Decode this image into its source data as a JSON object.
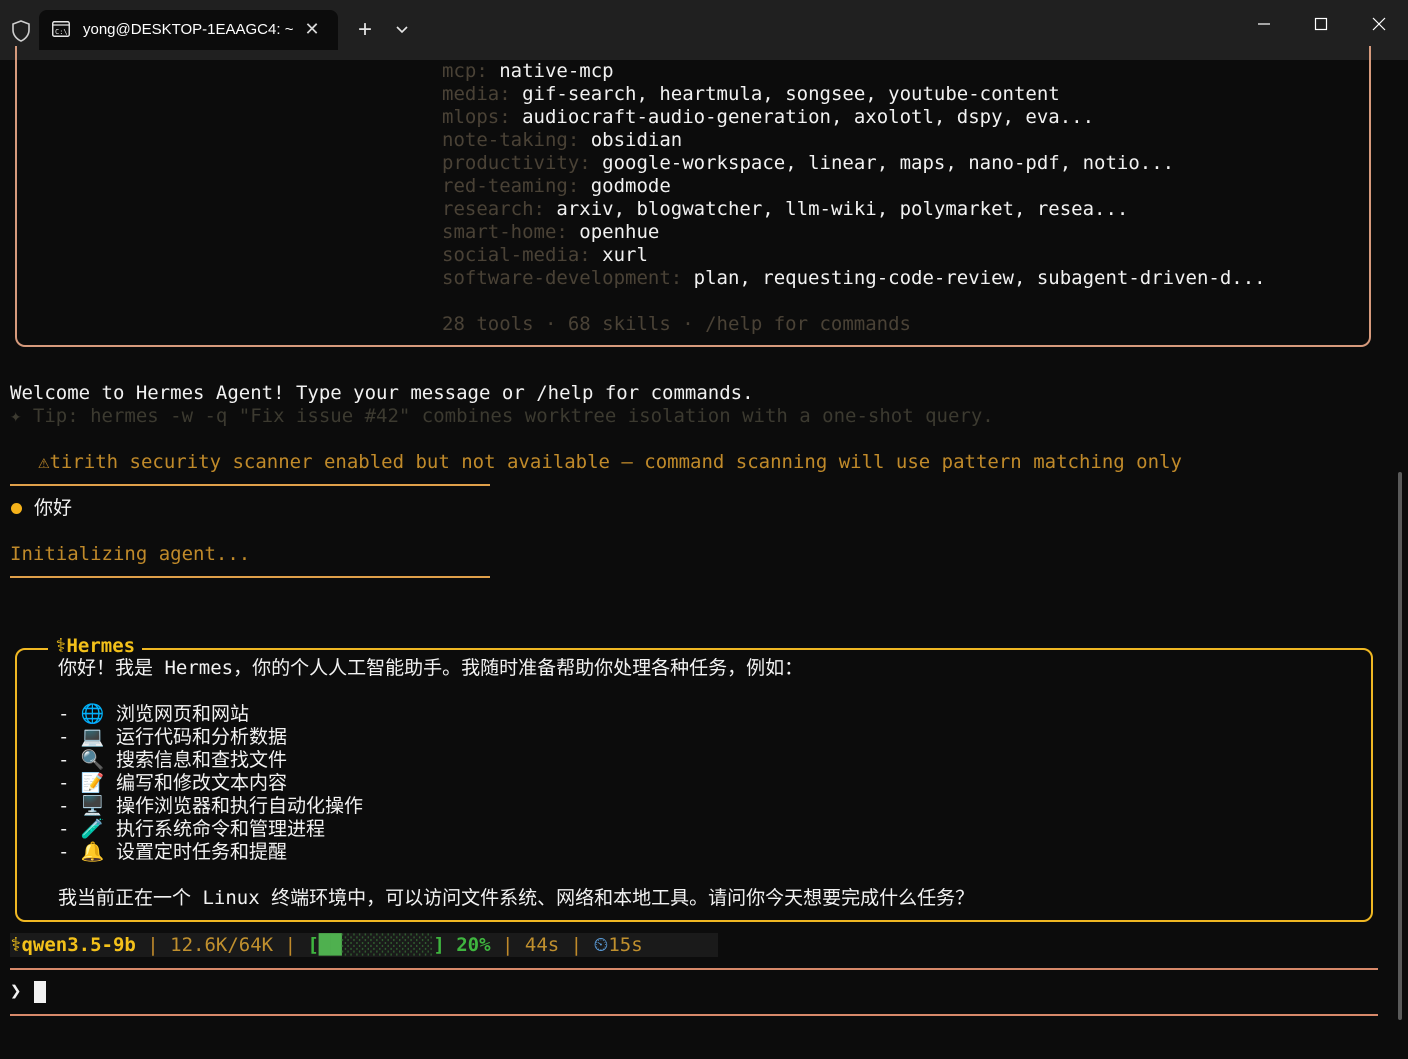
{
  "window": {
    "tab_title": "yong@DESKTOP-1EAAGC4: ~",
    "new_tab_label": "+"
  },
  "banner": {
    "skills": [
      {
        "category": "mcp:",
        "items": "native-mcp"
      },
      {
        "category": "media:",
        "items": "gif-search, heartmula, songsee, youtube-content"
      },
      {
        "category": "mlops:",
        "items": "audiocraft-audio-generation, axolotl, dspy, eva..."
      },
      {
        "category": "note-taking:",
        "items": "obsidian"
      },
      {
        "category": "productivity:",
        "items": "google-workspace, linear, maps, nano-pdf, notio..."
      },
      {
        "category": "red-teaming:",
        "items": "godmode"
      },
      {
        "category": "research:",
        "items": "arxiv, blogwatcher, llm-wiki, polymarket, resea..."
      },
      {
        "category": "smart-home:",
        "items": "openhue"
      },
      {
        "category": "social-media:",
        "items": "xurl"
      },
      {
        "category": "software-development:",
        "items": "plan, requesting-code-review, subagent-driven-d..."
      }
    ],
    "summary": "28 tools · 68 skills · /help for commands"
  },
  "welcome": "Welcome to Hermes Agent! Type your message or /help for commands.",
  "tip": "✦ Tip: hermes -w -q \"Fix issue #42\" combines worktree isolation with a one-shot query.",
  "warning": "⚠tirith security scanner enabled but not available — command scanning will use pattern matching only",
  "user_message": "你好",
  "initializing": "Initializing agent...",
  "assistant": {
    "label": "⚕Hermes",
    "intro": "你好！我是 Hermes，你的个人人工智能助手。我随时准备帮助你处理各种任务，例如：",
    "items": [
      "- 🌐 浏览网页和网站",
      "- 💻 运行代码和分析数据",
      "- 🔍 搜索信息和查找文件",
      "- 📝 编写和修改文本内容",
      "- 🖥️ 操作浏览器和执行自动化操作",
      "- 🧪 执行系统命令和管理进程",
      "- 🔔 设置定时任务和提醒"
    ],
    "closing": "我当前正在一个 Linux 终端环境中，可以访问文件系统、网络和本地工具。请问你今天想要完成什么任务？"
  },
  "status": {
    "model": "⚕qwen3.5-9b",
    "tokens": "12.6K/64K",
    "bar_open": "[",
    "bar_filled": "██",
    "bar_empty": "░░░░░░░░",
    "bar_close": "]",
    "percent": "20%",
    "context_fraction": 0.2,
    "elapsed": "44s",
    "timer_icon": "⏲",
    "timer": "15s",
    "separator": " | "
  },
  "prompt": {
    "symbol": "❯",
    "value": ""
  }
}
